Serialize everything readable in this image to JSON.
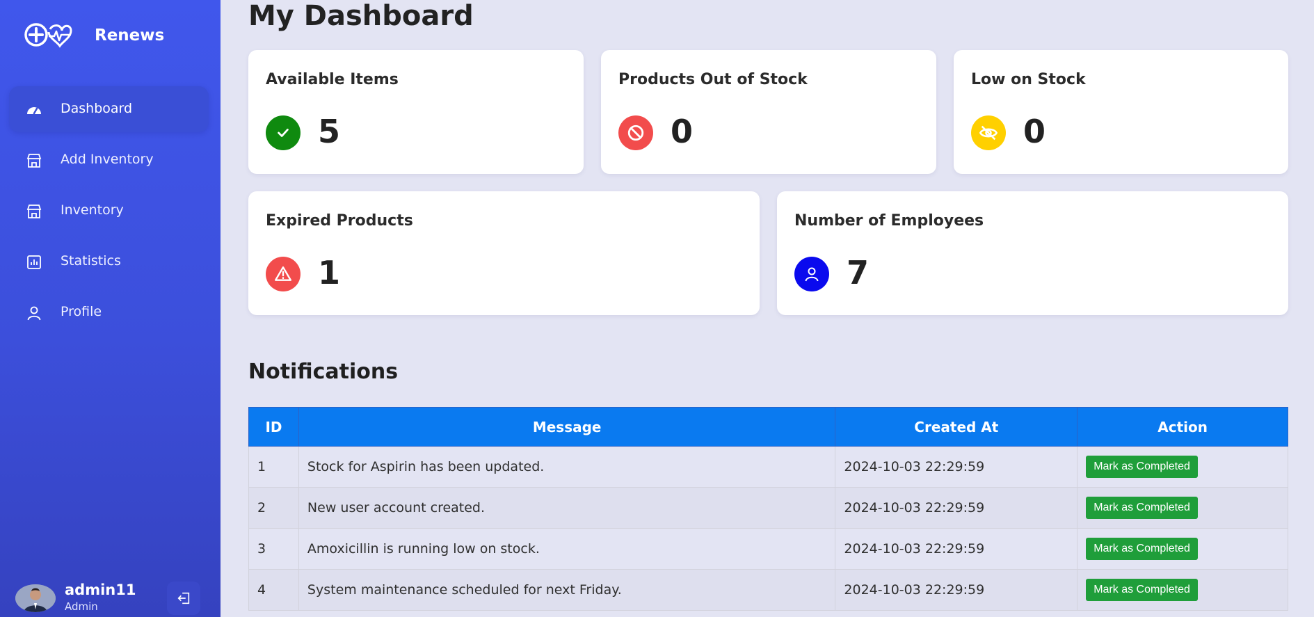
{
  "brand": {
    "name": "Renews"
  },
  "sidebar": {
    "items": [
      {
        "label": "Dashboard",
        "icon": "gauge-icon",
        "active": true
      },
      {
        "label": "Add Inventory",
        "icon": "store-icon"
      },
      {
        "label": "Inventory",
        "icon": "store-icon"
      },
      {
        "label": "Statistics",
        "icon": "bar-chart-icon"
      },
      {
        "label": "Profile",
        "icon": "user-icon"
      }
    ]
  },
  "user": {
    "name": "admin11",
    "role": "Admin"
  },
  "page": {
    "title": "My Dashboard"
  },
  "cards": [
    {
      "title": "Available Items",
      "value": "5",
      "icon": "check-icon",
      "color": "#0f8a0f"
    },
    {
      "title": "Products Out of Stock",
      "value": "0",
      "icon": "ban-icon",
      "color": "#f24c4c"
    },
    {
      "title": "Low on Stock",
      "value": "0",
      "icon": "eye-slash-icon",
      "color": "#ffd000"
    },
    {
      "title": "Expired Products",
      "value": "1",
      "icon": "warning-icon",
      "color": "#f24c4c"
    },
    {
      "title": "Number of Employees",
      "value": "7",
      "icon": "user-icon",
      "color": "#0a0aee"
    }
  ],
  "notifications": {
    "title": "Notifications",
    "columns": [
      "ID",
      "Message",
      "Created At",
      "Action"
    ],
    "rows": [
      {
        "id": "1",
        "message": "Stock for Aspirin has been updated.",
        "created_at": "2024-10-03 22:29:59",
        "action": "Mark as Completed"
      },
      {
        "id": "2",
        "message": "New user account created.",
        "created_at": "2024-10-03 22:29:59",
        "action": "Mark as Completed"
      },
      {
        "id": "3",
        "message": "Amoxicillin is running low on stock.",
        "created_at": "2024-10-03 22:29:59",
        "action": "Mark as Completed"
      },
      {
        "id": "4",
        "message": "System maintenance scheduled for next Friday.",
        "created_at": "2024-10-03 22:29:59",
        "action": "Mark as Completed"
      }
    ]
  },
  "colors": {
    "sidebar": "#4057ec",
    "header": "#0a7af0",
    "button": "#1f9e3a",
    "background": "#e3e4f3"
  }
}
